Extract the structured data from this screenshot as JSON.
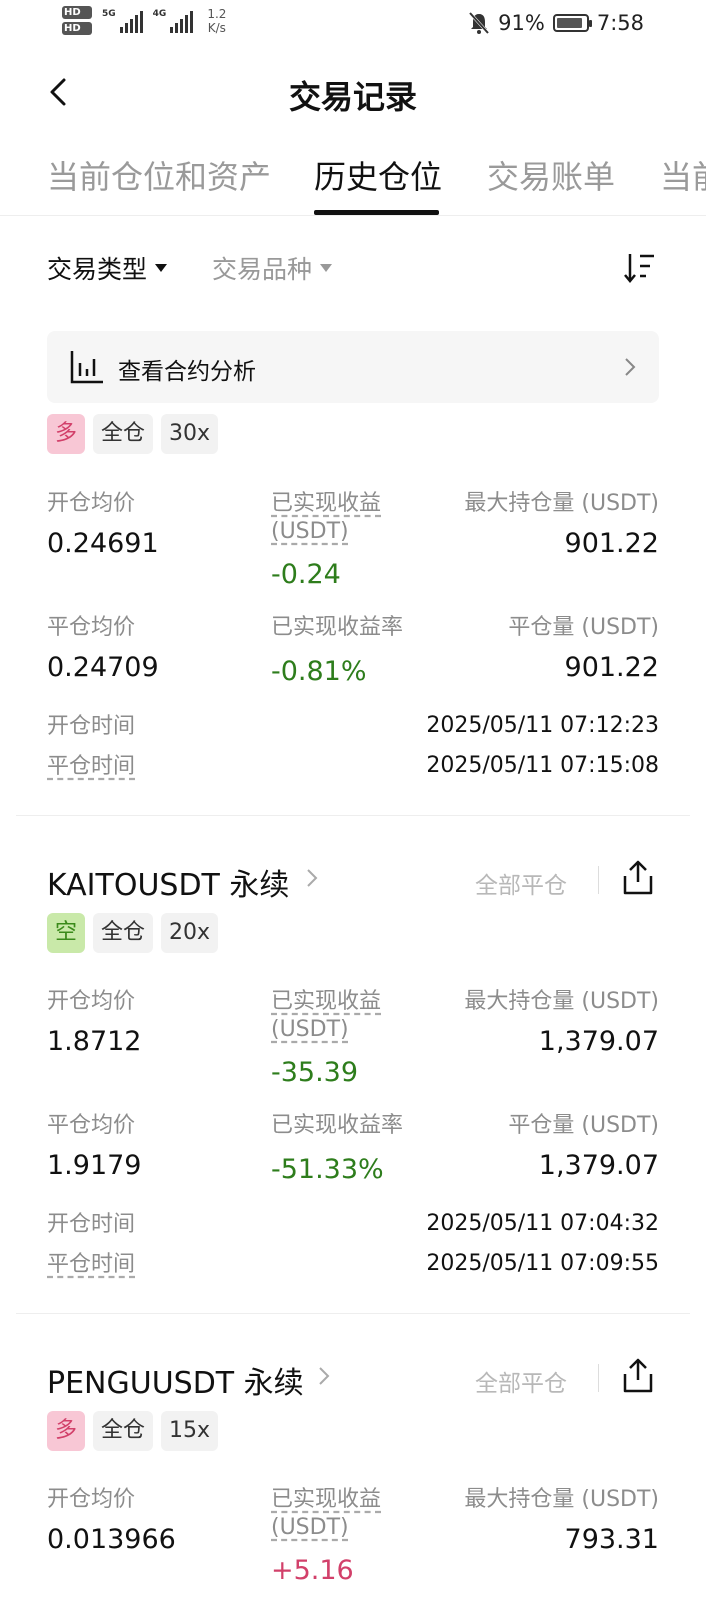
{
  "status_bar": {
    "hd1": "HD",
    "hd2": "HD",
    "net1": "5G",
    "net2": "4G",
    "speed_value": "1.2",
    "speed_unit": "K/s",
    "battery_percent": "91%",
    "battery_level": 0.91,
    "time": "7:58"
  },
  "header": {
    "title": "交易记录"
  },
  "tabs": [
    {
      "label": "当前仓位和资产"
    },
    {
      "label": "历史仓位"
    },
    {
      "label": "交易账单"
    },
    {
      "label": "当前"
    }
  ],
  "active_tab": 1,
  "filters": {
    "trade_type": "交易类型",
    "product": "交易品种"
  },
  "banner": {
    "label": "查看合约分析"
  },
  "labels": {
    "open_avg": "开仓均价",
    "realized_pnl": "已实现收益",
    "realized_pnl_unit": "(USDT)",
    "max_position": "最大持仓量 (USDT)",
    "close_avg": "平仓均价",
    "realized_rate": "已实现收益率",
    "close_qty": "平仓量 (USDT)",
    "open_time": "开仓时间",
    "close_time": "平仓时间",
    "close_all": "全部平仓"
  },
  "positions": [
    {
      "symbol": "",
      "side": "多",
      "margin": "全仓",
      "leverage": "30x",
      "open_avg": "0.24691",
      "realized_pnl": "-0.24",
      "max_position": "901.22",
      "close_avg": "0.24709",
      "realized_rate": "-0.81%",
      "close_qty": "901.22",
      "open_time": "2025/05/11 07:12:23",
      "close_time": "2025/05/11 07:15:08"
    },
    {
      "symbol": "KAITOUSDT 永续",
      "side": "空",
      "margin": "全仓",
      "leverage": "20x",
      "open_avg": "1.8712",
      "realized_pnl": "-35.39",
      "max_position": "1,379.07",
      "close_avg": "1.9179",
      "realized_rate": "-51.33%",
      "close_qty": "1,379.07",
      "open_time": "2025/05/11 07:04:32",
      "close_time": "2025/05/11 07:09:55"
    },
    {
      "symbol": "PENGUUSDT 永续",
      "side": "多",
      "margin": "全仓",
      "leverage": "15x",
      "open_avg": "0.013966",
      "realized_pnl": "+5.16",
      "max_position": "793.31"
    }
  ]
}
